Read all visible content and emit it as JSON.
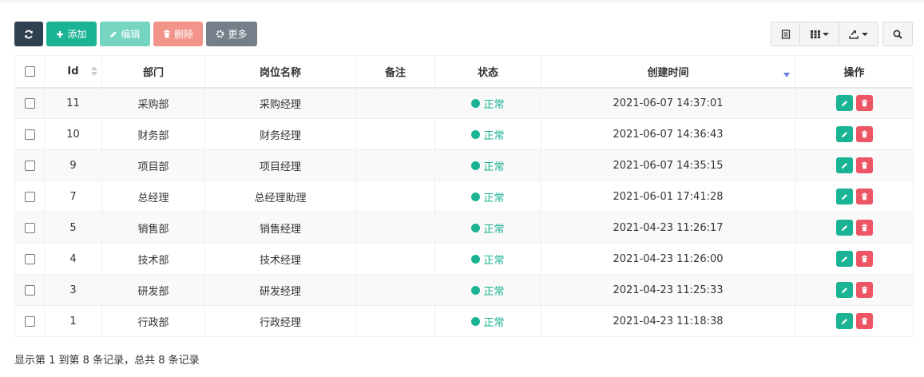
{
  "toolbar": {
    "add_label": "添加",
    "edit_label": "编辑",
    "delete_label": "删除",
    "more_label": "更多"
  },
  "table": {
    "headers": {
      "id": "Id",
      "dept": "部门",
      "post": "岗位名称",
      "remark": "备注",
      "status": "状态",
      "created": "创建时间",
      "ops": "操作"
    },
    "rows": [
      {
        "id": "11",
        "dept": "采购部",
        "post": "采购经理",
        "remark": "",
        "status": "正常",
        "created": "2021-06-07 14:37:01"
      },
      {
        "id": "10",
        "dept": "财务部",
        "post": "财务经理",
        "remark": "",
        "status": "正常",
        "created": "2021-06-07 14:36:43"
      },
      {
        "id": "9",
        "dept": "项目部",
        "post": "项目经理",
        "remark": "",
        "status": "正常",
        "created": "2021-06-07 14:35:15"
      },
      {
        "id": "7",
        "dept": "总经理",
        "post": "总经理助理",
        "remark": "",
        "status": "正常",
        "created": "2021-06-01 17:41:28"
      },
      {
        "id": "5",
        "dept": "销售部",
        "post": "销售经理",
        "remark": "",
        "status": "正常",
        "created": "2021-04-23 11:26:17"
      },
      {
        "id": "4",
        "dept": "技术部",
        "post": "技术经理",
        "remark": "",
        "status": "正常",
        "created": "2021-04-23 11:26:00"
      },
      {
        "id": "3",
        "dept": "研发部",
        "post": "研发经理",
        "remark": "",
        "status": "正常",
        "created": "2021-04-23 11:25:33"
      },
      {
        "id": "1",
        "dept": "行政部",
        "post": "行政经理",
        "remark": "",
        "status": "正常",
        "created": "2021-04-23 11:18:38"
      }
    ]
  },
  "footer": {
    "pagination_text": "显示第 1 到第 8 条记录，总共 8 条记录"
  },
  "colors": {
    "primary": "#1ab394",
    "danger": "#ed5565",
    "dark": "#2f4050",
    "gray": "#757f8a"
  }
}
